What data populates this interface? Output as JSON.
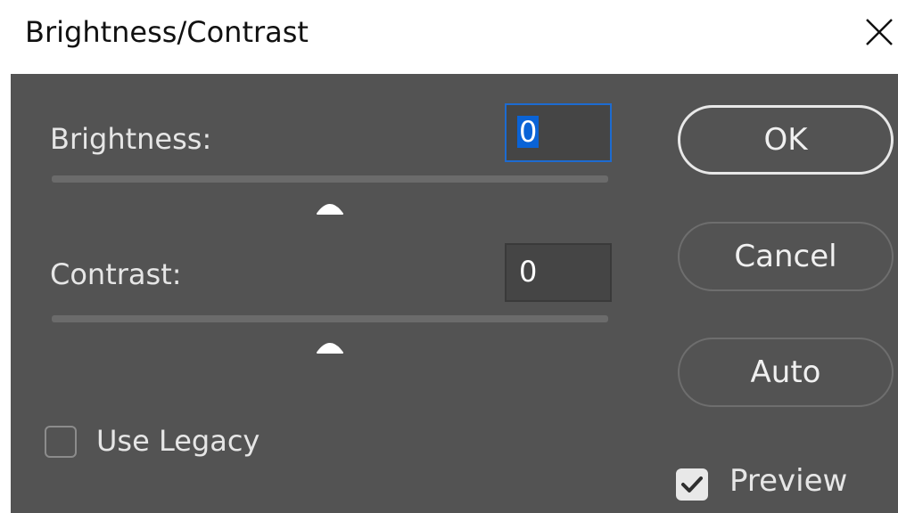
{
  "window": {
    "title": "Brightness/Contrast",
    "close_icon": "close-icon"
  },
  "brightness": {
    "label": "Brightness:",
    "value": "0",
    "slider_level_percent": 50
  },
  "contrast": {
    "label": "Contrast:",
    "value": "0",
    "slider_level_percent": 50
  },
  "buttons": {
    "ok": "OK",
    "cancel": "Cancel",
    "auto": "Auto"
  },
  "options": {
    "use_legacy_label": "Use Legacy",
    "use_legacy_checked": false,
    "preview_label": "Preview",
    "preview_checked": true
  },
  "colors": {
    "panel_bg": "#535353",
    "focus_accent": "#1d6bd1",
    "selection": "#0a63d6"
  }
}
